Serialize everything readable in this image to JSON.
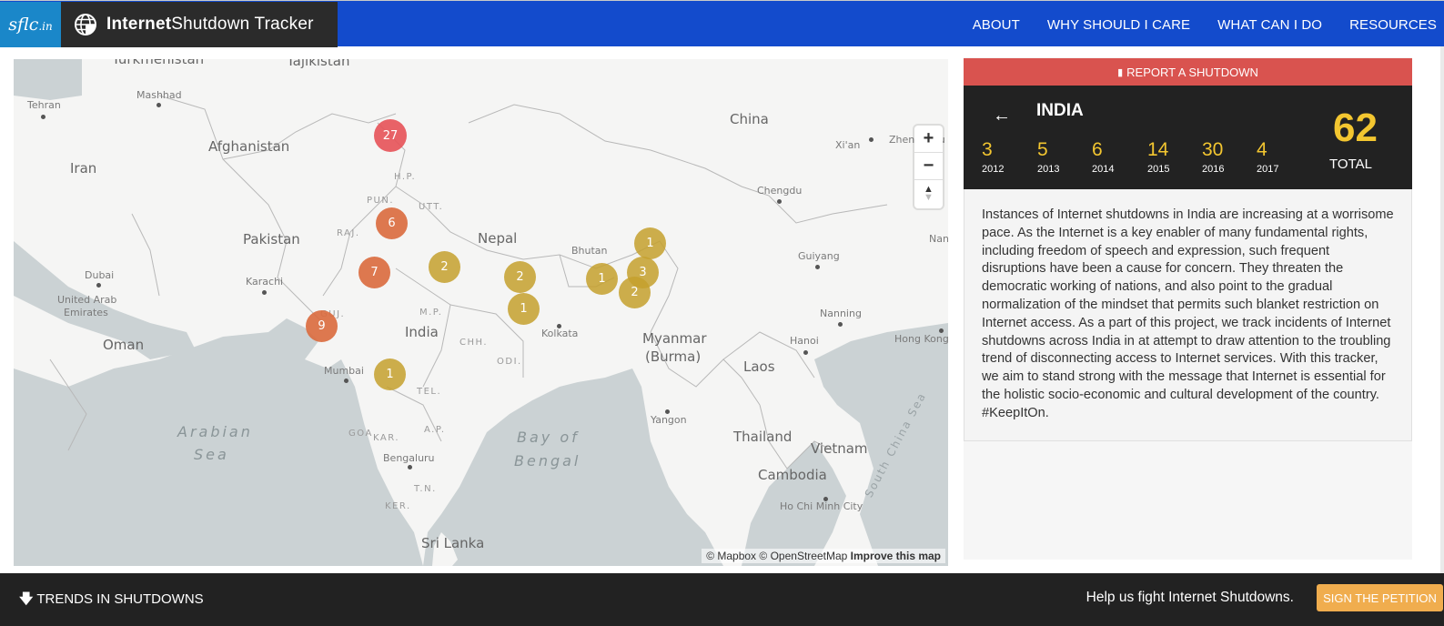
{
  "header": {
    "logo_text": "sflc",
    "logo_suffix": ".in",
    "brand_bold": "Internet",
    "brand_rest": "Shutdown Tracker",
    "nav": [
      {
        "label": "ABOUT"
      },
      {
        "label": "WHY SHOULD I CARE"
      },
      {
        "label": "WHAT CAN I DO"
      },
      {
        "label": "RESOURCES"
      }
    ]
  },
  "map": {
    "zoom_in": "+",
    "zoom_out": "−",
    "compass": "▲",
    "attribution": {
      "mapbox": "© Mapbox",
      "osm": "© OpenStreetMap",
      "improve": "Improve this map"
    },
    "countries": [
      "Turkmenistan",
      "Tajikistan",
      "Afghanistan",
      "Iran",
      "Pakistan",
      "Nepal",
      "Bhutan",
      "India",
      "China",
      "Myanmar",
      "(Burma)",
      "Laos",
      "Thailand",
      "Vietnam",
      "Cambodia",
      "Oman",
      "United Arab",
      "Emirates",
      "Sri Lanka"
    ],
    "cities": [
      "Tehran",
      "Mashhad",
      "Dubai",
      "Karachi",
      "Mumbai",
      "Kolkata",
      "Bengaluru",
      "Yangon",
      "Chengdu",
      "Xi'an",
      "Guiyang",
      "Nanning",
      "Hanoi",
      "Hong Kong",
      "Ho Chi Minh City",
      "Zhengzhou",
      "Nanchang"
    ],
    "states": [
      "H.P.",
      "PUN.",
      "UTT.",
      "RAJ.",
      "GUJ.",
      "M.P.",
      "CHH.",
      "ODI.",
      "TEL.",
      "A.P.",
      "GOA",
      "KAR.",
      "T.N.",
      "KER."
    ],
    "seas": [
      "Arabian",
      "Sea",
      "Bay of",
      "Bengal",
      "South China Sea"
    ],
    "clusters": [
      {
        "count": "27",
        "level": "high"
      },
      {
        "count": "6",
        "level": "medium"
      },
      {
        "count": "7",
        "level": "medium"
      },
      {
        "count": "9",
        "level": "medium"
      },
      {
        "count": "2",
        "level": "low"
      },
      {
        "count": "2",
        "level": "low"
      },
      {
        "count": "1",
        "level": "low"
      },
      {
        "count": "1",
        "level": "low"
      },
      {
        "count": "1",
        "level": "low"
      },
      {
        "count": "1",
        "level": "low"
      },
      {
        "count": "3",
        "level": "low"
      },
      {
        "count": "2",
        "level": "low"
      }
    ],
    "cluster_colors": {
      "high": "#e6555a",
      "medium": "#da6c40",
      "low": "#c4a02d"
    }
  },
  "panel": {
    "report_label": "REPORT A SHUTDOWN",
    "country": "INDIA",
    "years": [
      {
        "count": "3",
        "year": "2012"
      },
      {
        "count": "5",
        "year": "2013"
      },
      {
        "count": "6",
        "year": "2014"
      },
      {
        "count": "14",
        "year": "2015"
      },
      {
        "count": "30",
        "year": "2016"
      },
      {
        "count": "4",
        "year": "2017"
      }
    ],
    "total": "62",
    "total_label": "TOTAL",
    "description": "Instances of Internet shutdowns in India are increasing at a worrisome pace. As the Internet is a key enabler of many fundamental rights, including freedom of speech and expression, such frequent disruptions have been a cause for concern. They threaten the democratic working of nations, and also point to the gradual normalization of the mindset that permits such blanket restriction on Internet access. As a part of this project, we track incidents of Internet shutdowns across India in at attempt to draw attention to the troubling trend of disconnecting access to Internet services. With this tracker, we aim to stand strong with the message that Internet is essential for the holistic socio-economic and cultural development of the country. #KeepItOn."
  },
  "footer": {
    "trends_label": "TRENDS IN SHUTDOWNS",
    "help_text": "Help us fight Internet Shutdowns.",
    "petition_label": "SIGN THE PETITION"
  },
  "colors": {
    "header_bg": "#134bcc",
    "logo_bg": "#1a87c9",
    "brand_bg": "#2b2b2b",
    "report_bg": "#d9534f",
    "stats_bg": "#222222",
    "accent_yellow": "#f3c630",
    "petition_bg": "#f0ad4e"
  }
}
